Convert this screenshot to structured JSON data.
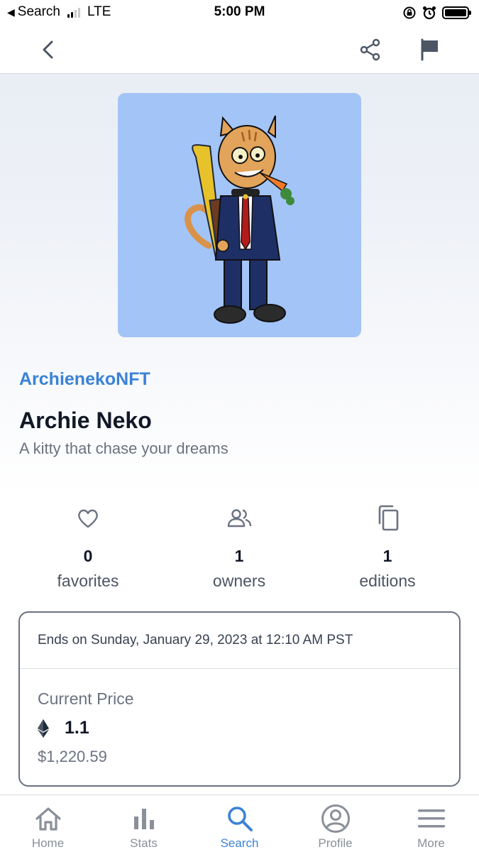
{
  "status_bar": {
    "back_app": "Search",
    "network": "LTE",
    "time": "5:00 PM"
  },
  "header": {
    "icons": [
      "chevron-left-icon",
      "share-icon",
      "flag-icon"
    ]
  },
  "nft": {
    "creator": "ArchienekoNFT",
    "name": "Archie Neko",
    "description": "A kitty that chase your dreams",
    "background_color": "#a3c4f7"
  },
  "stats": [
    {
      "icon": "heart-icon",
      "value": "0",
      "label": "favorites"
    },
    {
      "icon": "people-icon",
      "value": "1",
      "label": "owners"
    },
    {
      "icon": "copy-icon",
      "value": "1",
      "label": "editions"
    }
  ],
  "auction": {
    "ends": "Ends on Sunday, January 29, 2023 at 12:10 AM PST",
    "price_label": "Current Price",
    "price_eth": "1.1",
    "price_usd": "$1,220.59"
  },
  "tabs": [
    {
      "label": "Home",
      "icon": "home-icon",
      "active": false
    },
    {
      "label": "Stats",
      "icon": "bar-chart-icon",
      "active": false
    },
    {
      "label": "Search",
      "icon": "search-icon",
      "active": true
    },
    {
      "label": "Profile",
      "icon": "profile-icon",
      "active": false
    },
    {
      "label": "More",
      "icon": "menu-icon",
      "active": false
    }
  ],
  "colors": {
    "accent": "#3b82d6",
    "inactive": "#8a9099"
  }
}
